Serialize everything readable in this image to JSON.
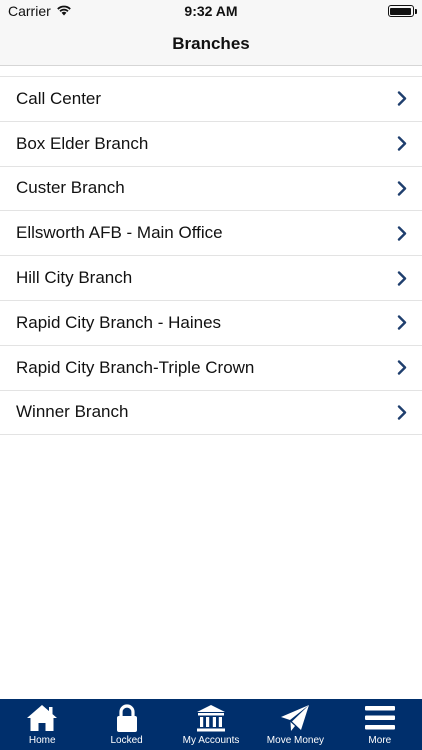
{
  "status_bar": {
    "carrier": "Carrier",
    "time": "9:32 AM"
  },
  "nav": {
    "title": "Branches"
  },
  "branches": [
    {
      "label": "Call Center"
    },
    {
      "label": "Box Elder Branch"
    },
    {
      "label": "Custer Branch"
    },
    {
      "label": "Ellsworth AFB - Main Office"
    },
    {
      "label": "Hill City Branch"
    },
    {
      "label": "Rapid City Branch - Haines"
    },
    {
      "label": "Rapid City Branch-Triple Crown"
    },
    {
      "label": "Winner Branch"
    }
  ],
  "tabs": [
    {
      "label": "Home",
      "icon": "home-icon"
    },
    {
      "label": "Locked",
      "icon": "lock-icon"
    },
    {
      "label": "My Accounts",
      "icon": "bank-icon"
    },
    {
      "label": "Move Money",
      "icon": "paper-plane-icon"
    },
    {
      "label": "More",
      "icon": "menu-icon"
    }
  ],
  "colors": {
    "tab_bar": "#002f6c",
    "chevron": "#1f3f6e",
    "nav_bg": "#f7f7f7"
  }
}
